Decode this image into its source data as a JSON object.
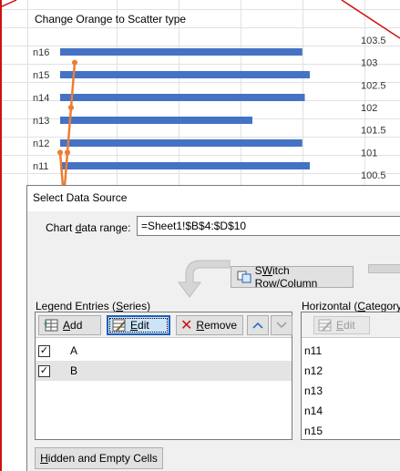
{
  "sheet": {
    "cell_text": "Change Orange to Scatter type"
  },
  "chart_data": {
    "type": "bar",
    "categories": [
      "n11",
      "n12",
      "n13",
      "n14",
      "n15",
      "n16"
    ],
    "series": [
      {
        "values": [
          100,
          97,
          77,
          98,
          100,
          97
        ],
        "color": "#4472c4"
      },
      {
        "type": "scatter",
        "x": [
          1,
          2,
          3,
          4,
          5,
          4,
          3,
          2
        ],
        "y": [
          101,
          100,
          101,
          102,
          103,
          102,
          101,
          100
        ],
        "color": "#ed7d31"
      }
    ],
    "secondary_y_ticks": [
      "100.5",
      "101",
      "101.5",
      "102",
      "102.5",
      "103",
      "103.5"
    ],
    "secondary_ylim": [
      100.5,
      103.5
    ]
  },
  "dialog": {
    "title": "Select Data Source",
    "range_label_pre": "Chart ",
    "range_label_acc": "d",
    "range_label_post": "ata range:",
    "range_value": "=Sheet1!$B$4:$D$10",
    "switch_label_acc": "W",
    "switch_label_post": "itch Row/Column",
    "switch_label_pre": "S",
    "legend_title_pre": "Legend Entries (",
    "legend_title_acc": "S",
    "legend_title_post": "eries)",
    "add_label_acc": "A",
    "add_label_post": "dd",
    "edit_label_acc": "E",
    "edit_label_post": "dit",
    "remove_label_acc": "R",
    "remove_label_post": "emove",
    "series": [
      {
        "name": "A",
        "checked": true
      },
      {
        "name": "B",
        "checked": true
      }
    ],
    "cat_title_pre": "Horizontal (",
    "cat_title_acc": "C",
    "cat_title_post": "ategory)",
    "cat_edit_label_acc": "E",
    "cat_edit_label_post": "dit",
    "categories": [
      "n11",
      "n12",
      "n13",
      "n14",
      "n15"
    ],
    "hidden_pre": "",
    "hidden_acc": "H",
    "hidden_post": "idden and Empty Cells"
  },
  "colors": {
    "bar": "#4472c4",
    "line": "#ed7d31",
    "accent": "#1f5fbf",
    "red_border": "#d01010"
  }
}
